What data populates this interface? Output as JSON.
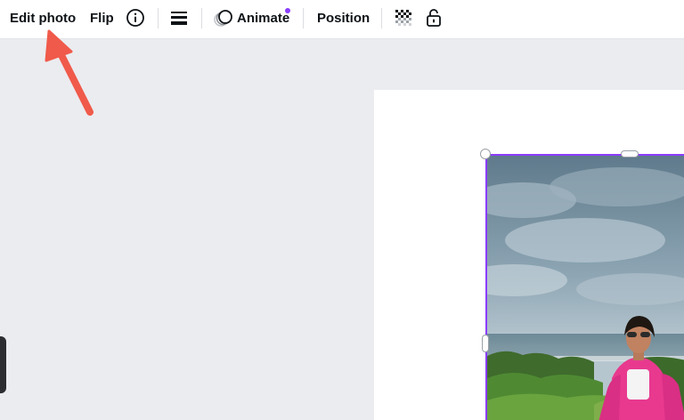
{
  "toolbar": {
    "edit_photo_label": "Edit photo",
    "flip_label": "Flip",
    "animate_label": "Animate",
    "position_label": "Position",
    "icons": [
      "info-icon",
      "line-weight-icon",
      "animate-icon",
      "transparency-icon",
      "lock-icon"
    ]
  },
  "colors": {
    "accent": "#8b3dff",
    "arrow": "#f05a4a",
    "canvas_bg": "#ebecf0",
    "toolbar_text": "#0d1216"
  }
}
